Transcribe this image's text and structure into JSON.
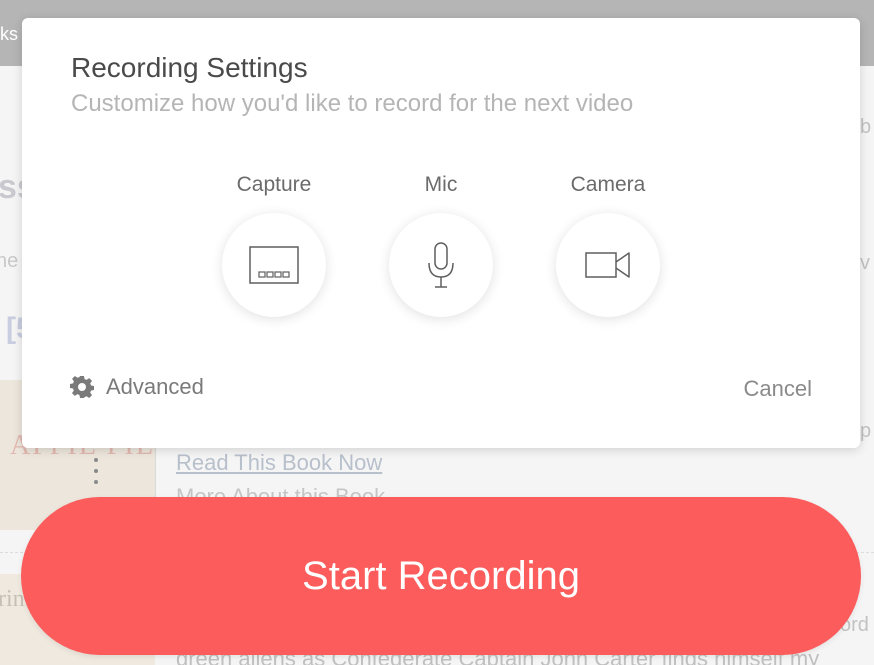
{
  "background": {
    "topbar_text": "ks",
    "left_bold": "ss",
    "left_small": "he",
    "left_bracket": "[5",
    "right_fragments": [
      "b",
      "v",
      "p",
      "ord"
    ],
    "cover_text": "APPIE PIE",
    "cover2_text": "rin",
    "links": {
      "read": "Read This Book Now",
      "more": "More About this Book"
    },
    "bottom_text": "green aliens as Confederate Captain John Carter finds himself my"
  },
  "modal": {
    "title": "Recording Settings",
    "subtitle": "Customize how you'd like to record for the next video",
    "options": [
      {
        "label": "Capture",
        "icon": "screen-capture-icon"
      },
      {
        "label": "Mic",
        "icon": "microphone-icon"
      },
      {
        "label": "Camera",
        "icon": "video-camera-icon"
      }
    ],
    "advanced_label": "Advanced",
    "cancel_label": "Cancel"
  },
  "start_button_label": "Start Recording",
  "colors": {
    "accent": "#fc5c5c",
    "title": "#4a4a4a",
    "subtitle": "#b5b5b5",
    "icon": "#5f5f5f"
  }
}
